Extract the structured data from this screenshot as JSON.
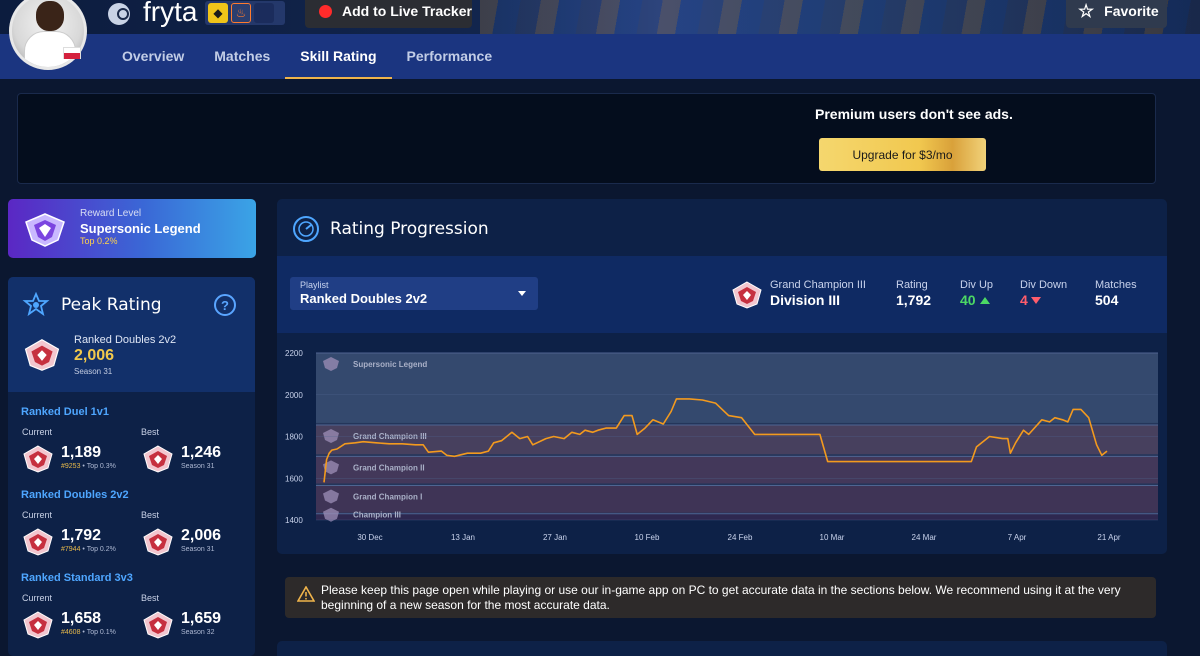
{
  "profile": {
    "username": "fryta",
    "avatar": "player-avatar",
    "flag": "poland-flag",
    "platform_icon": "steam-icon",
    "live_tracker_label": "Add to Live Tracker",
    "favorite_label": "Favorite"
  },
  "tabs": [
    {
      "label": "Overview",
      "active": false
    },
    {
      "label": "Matches",
      "active": false
    },
    {
      "label": "Skill Rating",
      "active": true
    },
    {
      "label": "Performance",
      "active": false
    }
  ],
  "ad": {
    "text": "Premium users don't see ads.",
    "upgrade_label": "Upgrade for $3/mo"
  },
  "reward": {
    "label": "Reward Level",
    "name": "Supersonic Legend",
    "top": "Top 0.2%"
  },
  "peak": {
    "title": "Peak Rating",
    "playlist": "Ranked Doubles 2v2",
    "value": "2,006",
    "season": "Season 31"
  },
  "playlists": [
    {
      "title": "Ranked Duel 1v1",
      "current_label": "Current",
      "best_label": "Best",
      "current": "1,189",
      "current_rank": "#9253",
      "current_top": "Top 0.3%",
      "best": "1,246",
      "best_season": "Season 31"
    },
    {
      "title": "Ranked Doubles 2v2",
      "current_label": "Current",
      "best_label": "Best",
      "current": "1,792",
      "current_rank": "#7944",
      "current_top": "Top 0.2%",
      "best": "2,006",
      "best_season": "Season 31"
    },
    {
      "title": "Ranked Standard 3v3",
      "current_label": "Current",
      "best_label": "Best",
      "current": "1,658",
      "current_rank": "#4608",
      "current_top": "Top 0.1%",
      "best": "1,659",
      "best_season": "Season 32"
    }
  ],
  "progression": {
    "title": "Rating Progression",
    "playlist_label": "Playlist",
    "playlist_value": "Ranked Doubles 2v2",
    "rank_name": "Grand Champion III",
    "division": "Division III",
    "rating_label": "Rating",
    "rating": "1,792",
    "div_up_label": "Div Up",
    "div_up": "40",
    "div_down_label": "Div Down",
    "div_down": "4",
    "matches_label": "Matches",
    "matches": "504"
  },
  "warning": "Please keep this page open while playing or use our in-game app on PC to get accurate data in the sections below. We recommend using it at the very beginning of a new season for the most accurate data.",
  "colors": {
    "accent": "#f0b44b",
    "line": "#f39a1e",
    "positive": "#4cd964",
    "negative": "#ff5d6c",
    "link": "#4ea6ff"
  },
  "chart_data": {
    "type": "line",
    "y_ticks": [
      "2200",
      "2000",
      "1800",
      "1600",
      "1400"
    ],
    "ylim": [
      1400,
      2200
    ],
    "x_ticks": [
      "30 Dec",
      "13 Jan",
      "27 Jan",
      "10 Feb",
      "24 Feb",
      "10 Mar",
      "24 Mar",
      "7 Apr",
      "21 Apr"
    ],
    "bands": [
      {
        "label": "Supersonic Legend",
        "from": 1865,
        "to": 2200
      },
      {
        "label": "Grand Champion III",
        "from": 1715,
        "to": 1855
      },
      {
        "label": "Grand Champion II",
        "from": 1575,
        "to": 1705
      },
      {
        "label": "Grand Champion I",
        "from": 1435,
        "to": 1565
      },
      {
        "label": "Champion III",
        "from": 1400,
        "to": 1430
      }
    ],
    "series": [
      {
        "x": [
          0,
          1,
          2,
          3,
          5,
          8,
          12,
          15,
          20,
          25,
          30,
          35,
          38,
          40,
          45,
          47,
          50,
          55,
          60,
          63,
          65,
          68,
          72,
          75,
          78,
          80,
          85,
          88,
          92,
          95,
          98,
          100,
          103,
          105,
          108,
          112,
          115,
          118,
          120,
          123,
          126,
          130,
          133,
          135,
          137,
          140,
          145,
          150,
          155,
          160,
          165,
          170,
          175,
          177,
          180,
          182,
          185,
          188,
          190,
          193,
          195,
          198,
          200,
          205,
          207,
          210,
          213,
          215,
          218,
          220,
          225,
          230,
          235,
          240,
          245,
          248,
          250,
          255,
          260,
          262,
          263,
          265,
          268,
          270,
          275,
          278,
          280,
          283,
          285,
          287,
          290,
          293,
          296,
          298,
          300
        ],
        "y": [
          1580,
          1690,
          1720,
          1735,
          1740,
          1765,
          1770,
          1775,
          1770,
          1765,
          1765,
          1760,
          1760,
          1725,
          1730,
          1710,
          1705,
          1720,
          1720,
          1730,
          1770,
          1780,
          1820,
          1790,
          1800,
          1760,
          1790,
          1800,
          1790,
          1820,
          1810,
          1830,
          1820,
          1830,
          1840,
          1840,
          1900,
          1900,
          1810,
          1840,
          1880,
          1860,
          1920,
          1980,
          1980,
          1980,
          1975,
          1960,
          1900,
          1890,
          1810,
          1810,
          1810,
          1810,
          1810,
          1810,
          1810,
          1810,
          1810,
          1680,
          1680,
          1680,
          1680,
          1680,
          1680,
          1680,
          1680,
          1680,
          1680,
          1680,
          1680,
          1680,
          1680,
          1680,
          1680,
          1680,
          1750,
          1800,
          1790,
          1790,
          1720,
          1770,
          1830,
          1810,
          1880,
          1870,
          1890,
          1880,
          1870,
          1930,
          1930,
          1890,
          1760,
          1710,
          1730
        ]
      }
    ]
  }
}
